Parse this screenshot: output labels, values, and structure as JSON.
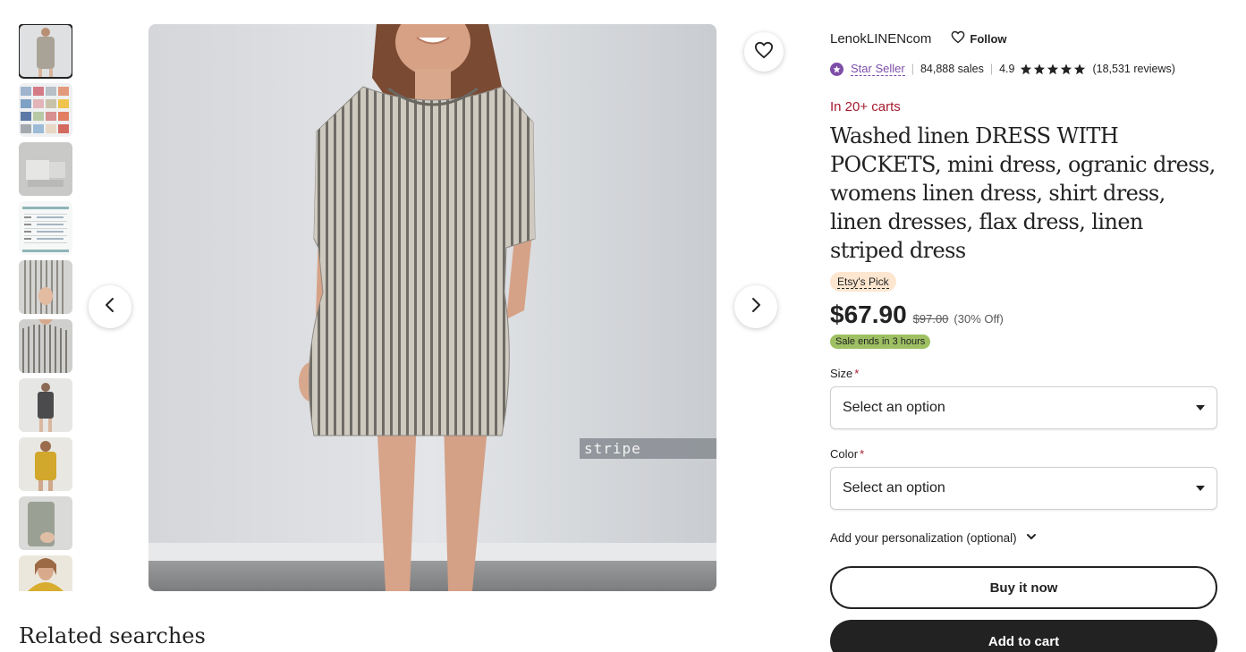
{
  "gallery": {
    "thumbnails": [
      {
        "label": "thumbnail-1",
        "active": true
      },
      {
        "label": "thumbnail-2"
      },
      {
        "label": "thumbnail-3"
      },
      {
        "label": "thumbnail-4"
      },
      {
        "label": "thumbnail-5"
      },
      {
        "label": "thumbnail-6"
      },
      {
        "label": "thumbnail-7"
      },
      {
        "label": "thumbnail-8"
      },
      {
        "label": "thumbnail-9"
      },
      {
        "label": "thumbnail-10"
      }
    ],
    "overlay_tag": "stripe",
    "prev_icon": "chevron-left-icon",
    "next_icon": "chevron-right-icon",
    "favorite_icon": "heart-outline-icon"
  },
  "related": {
    "heading": "Related searches"
  },
  "shop": {
    "name": "LenokLINENcom",
    "follow_label": "Follow",
    "badge_label": "Star Seller",
    "sales": "84,888 sales",
    "rating": "4.9",
    "stars": 5,
    "reviews": "(18,531 reviews)"
  },
  "listing": {
    "carts_text": "In 20+ carts",
    "title": "Washed linen DRESS WITH POCKETS, mini dress, ogranic dress, womens linen dress, shirt dress, linen dresses, flax dress, linen striped dress",
    "pick_label": "Etsy's Pick",
    "price": "$67.90",
    "original_price": "$97.00",
    "discount": "(30% Off)",
    "sale_badge": "Sale ends in 3 hours"
  },
  "options": {
    "size_label": "Size",
    "size_value": "Select an option",
    "color_label": "Color",
    "color_value": "Select an option",
    "required_mark": "*",
    "personalization_label": "Add your personalization (optional)"
  },
  "actions": {
    "buy_now": "Buy it now",
    "add_to_cart": "Add to cart"
  },
  "colors": {
    "text": "#222222",
    "accent_purple": "#7d4ea8",
    "alert_red": "#a61a2e",
    "pick_bg": "#fde6cf",
    "sale_green": "#9ec063"
  }
}
